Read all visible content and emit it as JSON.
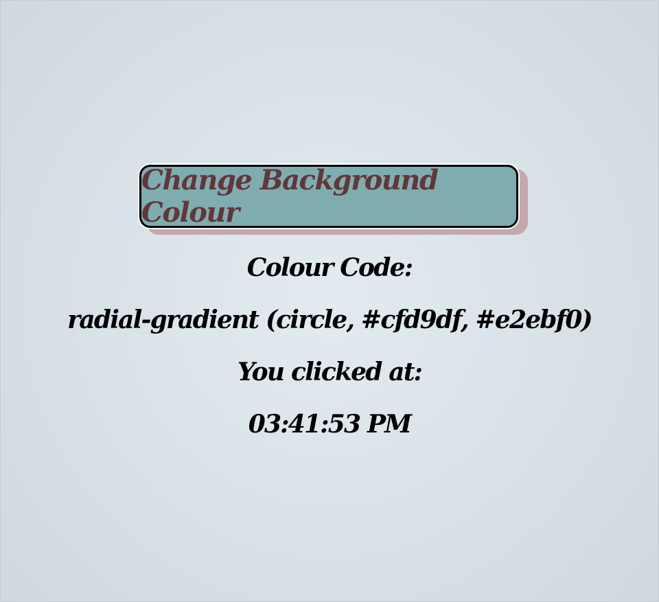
{
  "button": {
    "label": "Change Background Colour"
  },
  "colour": {
    "heading": "Colour Code:",
    "value": "radial-gradient (circle, #cfd9df, #e2ebf0)"
  },
  "click": {
    "heading": "You clicked at:",
    "time": "03:41:53 PM"
  },
  "colors": {
    "gradient_inner": "#e2ebf0",
    "gradient_outer": "#cfd9df",
    "button_bg": "#7fadaf",
    "button_text": "#62363a",
    "button_shadow": "#c6a7ad"
  }
}
